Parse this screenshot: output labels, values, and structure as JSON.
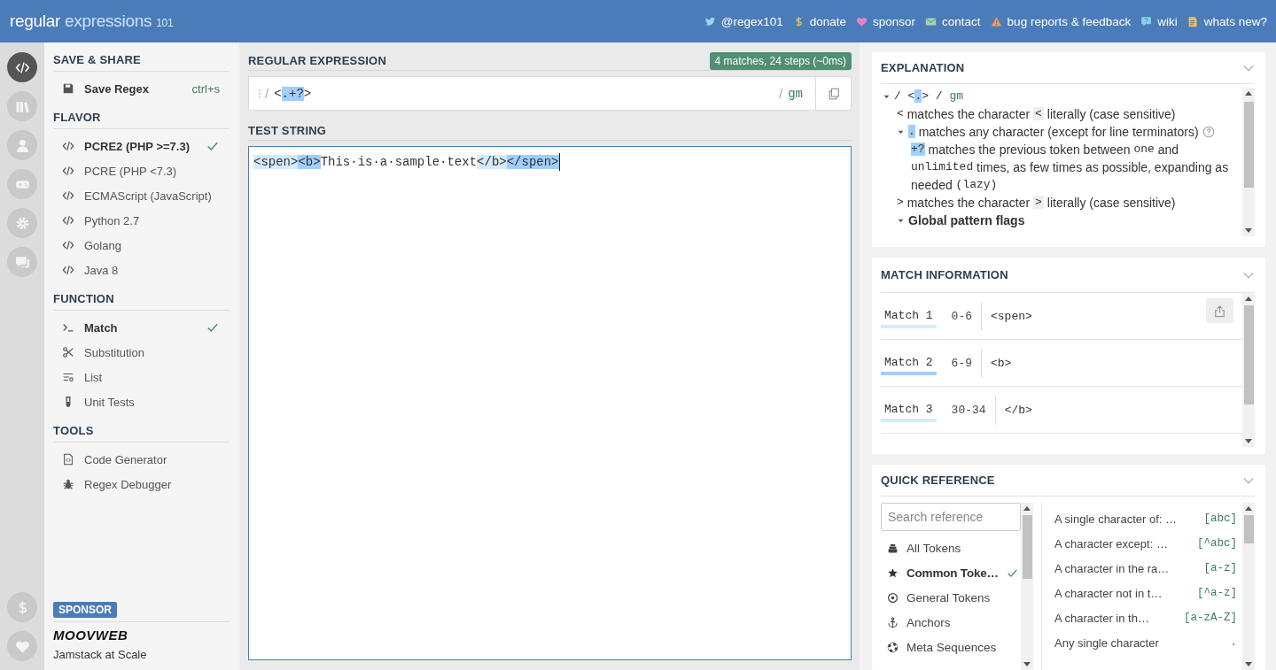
{
  "header": {
    "logo_main": "regular",
    "logo_accent": "expressions",
    "version": "101",
    "links": [
      {
        "label": "@regex101"
      },
      {
        "label": "donate"
      },
      {
        "label": "sponsor"
      },
      {
        "label": "contact"
      },
      {
        "label": "bug reports & feedback"
      },
      {
        "label": "wiki"
      },
      {
        "label": "whats new?"
      }
    ]
  },
  "rail": {
    "top": [
      {
        "selected": true
      },
      {
        "selected": false
      },
      {
        "selected": false
      },
      {
        "selected": false
      },
      {
        "selected": false
      },
      {
        "selected": false
      }
    ],
    "bottom": [
      {
        "selected": false
      },
      {
        "selected": false
      }
    ]
  },
  "sidebar": {
    "sections": [
      {
        "title": "SAVE & SHARE",
        "items": [
          {
            "kind": "action",
            "label": "Save Regex",
            "shortcut": "ctrl+s"
          }
        ]
      },
      {
        "title": "FLAVOR",
        "items": [
          {
            "kind": "option",
            "label": "PCRE2 (PHP >=7.3)",
            "selected": true
          },
          {
            "kind": "option",
            "label": "PCRE (PHP <7.3)",
            "selected": false
          },
          {
            "kind": "option",
            "label": "ECMAScript (JavaScript)",
            "selected": false
          },
          {
            "kind": "option",
            "label": "Python 2.7",
            "selected": false
          },
          {
            "kind": "option",
            "label": "Golang",
            "selected": false
          },
          {
            "kind": "option",
            "label": "Java 8",
            "selected": false
          }
        ]
      },
      {
        "title": "FUNCTION",
        "items": [
          {
            "kind": "option",
            "label": "Match",
            "selected": true
          },
          {
            "kind": "option",
            "label": "Substitution",
            "selected": false
          },
          {
            "kind": "option",
            "label": "List",
            "selected": false
          },
          {
            "kind": "option",
            "label": "Unit Tests",
            "selected": false
          }
        ]
      },
      {
        "title": "TOOLS",
        "items": [
          {
            "kind": "link",
            "label": "Code Generator"
          },
          {
            "kind": "link",
            "label": "Regex Debugger"
          }
        ]
      }
    ],
    "sponsor": {
      "badge": "SPONSOR",
      "brand": "MOOVWEB",
      "tagline": "Jamstack at Scale"
    }
  },
  "editor": {
    "regex_label": "REGULAR EXPRESSION",
    "status": "4 matches, 24 steps (~0ms)",
    "delimiter_open": "/",
    "regex": [
      {
        "text": "<",
        "highlight": false
      },
      {
        "text": ".+?",
        "highlight": true
      },
      {
        "text": ">",
        "highlight": false
      }
    ],
    "delimiter_close": "/",
    "flags": "gm",
    "test_label": "TEST STRING",
    "test": [
      {
        "text": "<spen>",
        "color": "#d5ebff"
      },
      {
        "text": "<b>",
        "color": "#9fcfff"
      },
      {
        "text": "This·is·a·sample·text"
      },
      {
        "text": "</b>",
        "color": "#d5ebff"
      },
      {
        "text": "</spen>",
        "color": "#9fcfff"
      }
    ]
  },
  "explanation": {
    "title": "EXPLANATION",
    "tree": [
      {
        "expanded": true,
        "parts": [
          {
            "text": "/ <",
            "kind": "code"
          },
          {
            "text": ".",
            "kind": "token"
          },
          {
            "text": "> / ",
            "kind": "code"
          },
          {
            "text": "gm",
            "kind": "flag"
          }
        ],
        "children": [
          {
            "parts": [
              {
                "text": "<",
                "kind": "code"
              },
              {
                "text": " matches the character ",
                "kind": "plain"
              },
              {
                "text": "<",
                "kind": "literal"
              },
              {
                "text": " literally (case sensitive)",
                "kind": "plain"
              }
            ]
          },
          {
            "expanded": true,
            "help": true,
            "parts": [
              {
                "text": ".",
                "kind": "token"
              },
              {
                "text": " matches any character (except for line terminators)",
                "kind": "plain"
              }
            ],
            "children": [
              {
                "parts": [
                  {
                    "text": "+?",
                    "kind": "token"
                  },
                  {
                    "text": " matches the previous token between ",
                    "kind": "plain"
                  },
                  {
                    "text": "one",
                    "kind": "code"
                  },
                  {
                    "text": " and ",
                    "kind": "plain"
                  },
                  {
                    "text": "unlimited",
                    "kind": "code"
                  },
                  {
                    "text": " times, as few times as possible, expanding as needed ",
                    "kind": "plain"
                  },
                  {
                    "text": "(lazy)",
                    "kind": "code"
                  }
                ]
              }
            ]
          },
          {
            "parts": [
              {
                "text": ">",
                "kind": "code"
              },
              {
                "text": " matches the character ",
                "kind": "plain"
              },
              {
                "text": ">",
                "kind": "literal"
              },
              {
                "text": " literally (case sensitive)",
                "kind": "plain"
              }
            ]
          },
          {
            "expanded": true,
            "kind": "heading",
            "parts": [
              {
                "text": "Global pattern flags",
                "kind": "plain"
              }
            ]
          }
        ]
      }
    ]
  },
  "match_info": {
    "title": "MATCH INFORMATION",
    "matches": [
      {
        "label": "Match 1",
        "range": "0-6",
        "text": "<spen>",
        "color": "#d5ebff"
      },
      {
        "label": "Match 2",
        "range": "6-9",
        "text": "<b>",
        "color": "#9fcfff"
      },
      {
        "label": "Match 3",
        "range": "30-34",
        "text": "</b>",
        "color": "#d5ebff"
      }
    ]
  },
  "quick_reference": {
    "title": "QUICK REFERENCE",
    "search_placeholder": "Search reference",
    "categories": [
      {
        "label": "All Tokens",
        "selected": false
      },
      {
        "label": "Common Toke…",
        "selected": true
      },
      {
        "label": "General Tokens",
        "selected": false
      },
      {
        "label": "Anchors",
        "selected": false
      },
      {
        "label": "Meta Sequences",
        "selected": false
      }
    ],
    "tokens": [
      {
        "description": "A single character of: …",
        "token": "[abc]"
      },
      {
        "description": "A character except: …",
        "token": "[^abc]"
      },
      {
        "description": "A character in the ra…",
        "token": "[a-z]"
      },
      {
        "description": "A character not in t…",
        "token": "[^a-z]"
      },
      {
        "description": "A character in th…",
        "token": "[a-zA-Z]"
      },
      {
        "description": "Any single character",
        "token": "."
      }
    ]
  }
}
